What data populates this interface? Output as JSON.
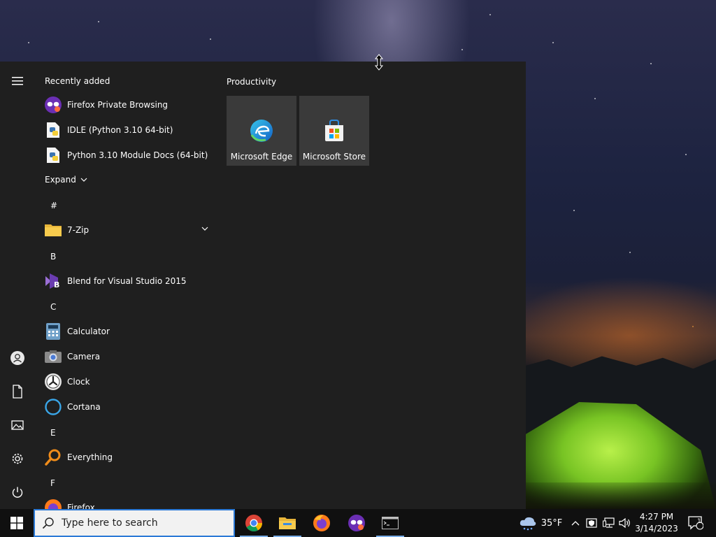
{
  "start_menu": {
    "recently_added_label": "Recently added",
    "recent_items": [
      {
        "label": "Firefox Private Browsing",
        "icon": "firefox-private-icon"
      },
      {
        "label": "IDLE (Python 3.10 64-bit)",
        "icon": "python-idle-icon"
      },
      {
        "label": "Python 3.10 Module Docs (64-bit)",
        "icon": "python-docs-icon"
      }
    ],
    "expand_label": "Expand",
    "sections": [
      {
        "letter": "#",
        "items": [
          {
            "label": "7-Zip",
            "icon": "folder-icon",
            "expandable": true
          }
        ]
      },
      {
        "letter": "B",
        "items": [
          {
            "label": "Blend for Visual Studio 2015",
            "icon": "blend-icon"
          }
        ]
      },
      {
        "letter": "C",
        "items": [
          {
            "label": "Calculator",
            "icon": "calculator-icon"
          },
          {
            "label": "Camera",
            "icon": "camera-icon"
          },
          {
            "label": "Clock",
            "icon": "clock-icon"
          },
          {
            "label": "Cortana",
            "icon": "cortana-icon"
          }
        ]
      },
      {
        "letter": "E",
        "items": [
          {
            "label": "Everything",
            "icon": "everything-icon"
          }
        ]
      },
      {
        "letter": "F",
        "items": [
          {
            "label": "Firefox",
            "icon": "firefox-icon"
          }
        ]
      }
    ],
    "tile_group": {
      "title": "Productivity",
      "tiles": [
        {
          "label": "Microsoft Edge",
          "icon": "edge-icon"
        },
        {
          "label": "Microsoft Store",
          "icon": "store-icon"
        }
      ]
    },
    "rail_icons": [
      "hamburger-menu-icon",
      "user-icon",
      "documents-icon",
      "pictures-icon",
      "settings-icon",
      "power-icon"
    ]
  },
  "taskbar": {
    "search_placeholder": "Type here to search",
    "pinned_apps": [
      "chrome-icon",
      "file-explorer-icon",
      "firefox-icon",
      "firefox-private-icon",
      "terminal-icon"
    ],
    "weather": {
      "temperature": "35°F",
      "icon": "weather-cloud-icon"
    },
    "clock": {
      "time": "4:27 PM",
      "date": "3/14/2023"
    },
    "notification_count": "1"
  },
  "colors": {
    "menu_bg": "#1f1f1f",
    "tile_bg": "#3a3a3a",
    "taskbar_bg": "#101010",
    "search_border": "#2b79d6",
    "accent_underline": "#7aaee8"
  }
}
